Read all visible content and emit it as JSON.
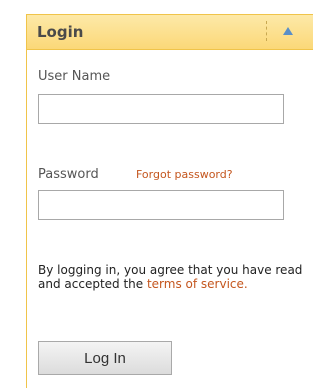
{
  "login_panel": {
    "title": "Login",
    "collapse_icon": "chevron-up-icon",
    "username": {
      "label": "User Name",
      "value": "",
      "placeholder": ""
    },
    "password": {
      "label": "Password",
      "value": "",
      "placeholder": ""
    },
    "forgot_link": "Forgot password?",
    "agreement": {
      "text_before": "By logging in, you agree that you have read and accepted the ",
      "terms_link": "terms of service",
      "text_after": "."
    },
    "login_button": "Log In"
  },
  "colors": {
    "header_bg": "#fbd878",
    "border": "#f0c44a",
    "link": "#c4561e",
    "collapse_arrow": "#5a8fc8"
  }
}
